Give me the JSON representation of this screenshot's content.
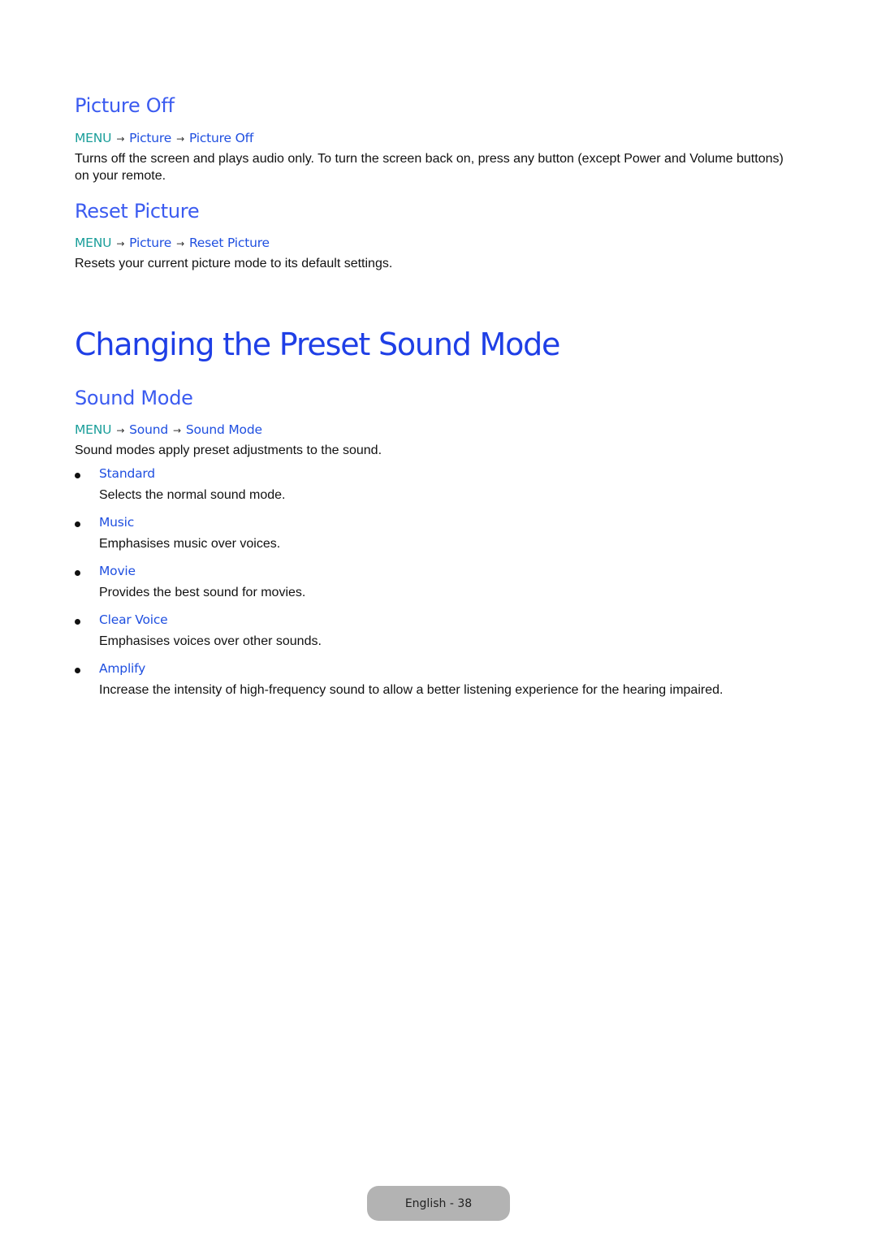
{
  "sections": {
    "picture_off": {
      "title": "Picture Off",
      "path": {
        "menu": "MENU",
        "arrow": "→",
        "step1": "Picture",
        "step2": "Picture Off"
      },
      "body": "Turns off the screen and plays audio only. To turn the screen back on, press any button (except Power and Volume buttons) on your remote."
    },
    "reset_picture": {
      "title": "Reset Picture",
      "path": {
        "menu": "MENU",
        "arrow": "→",
        "step1": "Picture",
        "step2": "Reset Picture"
      },
      "body": "Resets your current picture mode to its default settings."
    }
  },
  "chapter": {
    "title": "Changing the Preset Sound Mode",
    "sound_mode": {
      "title": "Sound Mode",
      "path": {
        "menu": "MENU",
        "arrow": "→",
        "step1": "Sound",
        "step2": "Sound Mode"
      },
      "body": "Sound modes apply preset adjustments to the sound.",
      "items": [
        {
          "label": "Standard",
          "desc": "Selects the normal sound mode."
        },
        {
          "label": "Music",
          "desc": "Emphasises music over voices."
        },
        {
          "label": "Movie",
          "desc": "Provides the best sound for movies."
        },
        {
          "label": "Clear Voice",
          "desc": "Emphasises voices over other sounds."
        },
        {
          "label": "Amplify",
          "desc": "Increase the intensity of high-frequency sound to allow a better listening experience for the hearing impaired."
        }
      ]
    }
  },
  "footer": {
    "page_label": "English - 38"
  }
}
